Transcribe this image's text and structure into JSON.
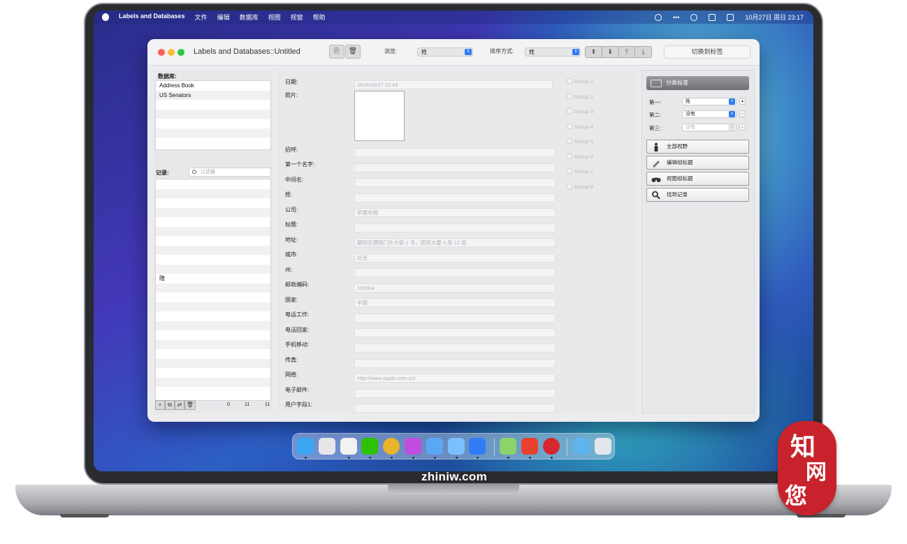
{
  "menubar": {
    "menus": [
      "Labels and Databases",
      "文件",
      "编辑",
      "数据库",
      "视图",
      "视窗",
      "帮助"
    ],
    "clock": "10月27日 周日  23:17",
    "status_dots": "•••"
  },
  "window": {
    "title": "Labels and  Databases::Untitled",
    "browse_label": "浏览:",
    "browse_value": "姓",
    "sort_label": "排序方式:",
    "sort_value": "姓",
    "switch_button": "切换到标签"
  },
  "left": {
    "db_label": "数据库:",
    "databases": [
      "Address Book",
      "US Senators",
      "",
      "",
      "",
      "",
      ""
    ],
    "records_label": "记录:",
    "search_placeholder": "过滤器",
    "record_item": "隐",
    "counts": [
      "0",
      "11",
      "11"
    ]
  },
  "fields": [
    {
      "label": "日期:",
      "value": "2024/10/27 22:43"
    },
    {
      "label": "照片:",
      "value": ""
    },
    {
      "label": "招呼:",
      "value": ""
    },
    {
      "label": "第一个名字:",
      "value": ""
    },
    {
      "label": "中间名:",
      "value": ""
    },
    {
      "label": "姓:",
      "value": ""
    },
    {
      "label": "公司:",
      "value": "苹果中国"
    },
    {
      "label": "标题:",
      "value": ""
    },
    {
      "label": "地址:",
      "value": "朝阳区建国门外大街 1 号，国贸大厦 3 座 12 层"
    },
    {
      "label": "城市:",
      "value": "北京"
    },
    {
      "label": "州:",
      "value": ""
    },
    {
      "label": "邮政编码:",
      "value": "100004"
    },
    {
      "label": "国家:",
      "value": "中国"
    },
    {
      "label": "电话工作:",
      "value": ""
    },
    {
      "label": "电话回家:",
      "value": ""
    },
    {
      "label": "手机移动:",
      "value": ""
    },
    {
      "label": "传真:",
      "value": ""
    },
    {
      "label": "网络:",
      "value": "http://www.apple.com.cn/"
    },
    {
      "label": "电子邮件:",
      "value": ""
    },
    {
      "label": "用户字段1:",
      "value": ""
    }
  ],
  "groups": [
    "Group 1",
    "Group 2",
    "Group 3",
    "Group 4",
    "Group 5",
    "Group 6",
    "Group 7",
    "Group 8"
  ],
  "right": {
    "sort_button": "分类标准",
    "first_label": "第一:",
    "first_value": "姓",
    "second_label": "第二:",
    "second_value": "没有",
    "third_label": "第三:",
    "third_value": "没有",
    "actions": [
      "全部视野",
      "编辑组标题",
      "视图组标题",
      "找到记录"
    ]
  },
  "laptop_brand": "zhiniw.com",
  "badge_chars": [
    "知",
    "网",
    "您"
  ],
  "colors": {
    "accent": "#2f7cf6",
    "badge": "#c8232c"
  }
}
